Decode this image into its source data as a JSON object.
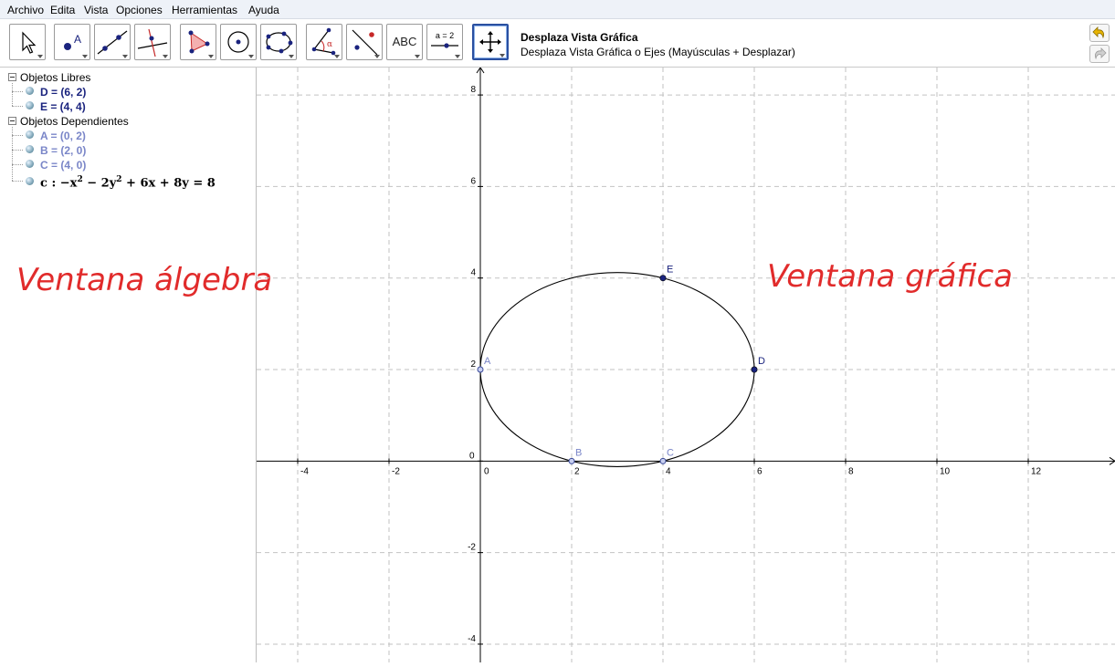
{
  "menu": [
    "Archivo",
    "Edita",
    "Vista",
    "Opciones",
    "Herramientas",
    "Ayuda"
  ],
  "toolbar": {
    "tools": [
      {
        "name": "move-tool-button",
        "icon": "arrow-pointer-icon"
      },
      {
        "name": "point-tool-button",
        "icon": "point-icon"
      },
      {
        "name": "line-tool-button",
        "icon": "line-through-points-icon"
      },
      {
        "name": "perpendicular-tool-button",
        "icon": "perpendicular-line-icon"
      },
      {
        "name": "polygon-tool-button",
        "icon": "polygon-icon"
      },
      {
        "name": "circle-tool-button",
        "icon": "circle-center-point-icon"
      },
      {
        "name": "conic-tool-button",
        "icon": "conic-five-points-icon"
      },
      {
        "name": "angle-tool-button",
        "icon": "angle-icon"
      },
      {
        "name": "reflect-tool-button",
        "icon": "reflect-line-icon"
      },
      {
        "name": "text-tool-button",
        "icon": "text-icon",
        "label": "ABC"
      },
      {
        "name": "slider-tool-button",
        "icon": "slider-icon",
        "label": "a = 2"
      },
      {
        "name": "move-graphics-view-tool-button",
        "icon": "move-view-icon",
        "active": true
      }
    ],
    "help_title": "Desplaza Vista Gráfica",
    "help_desc": "Desplaza Vista Gráfica o Ejes (Mayúsculas + Desplazar)",
    "undo_icon": "undo-icon",
    "redo_icon": "redo-icon"
  },
  "algebra": {
    "free_header": "Objetos Libres",
    "free_items": [
      "D = (6, 2)",
      "E = (4, 4)"
    ],
    "dependent_header": "Objetos Dependientes",
    "dependent_items": [
      "A = (0, 2)",
      "B = (2, 0)",
      "C = (4, 0)"
    ],
    "conic_name": "c :",
    "conic_eq": {
      "p1": "−x",
      "p2": " − 2y",
      "p3": " + 6x + 8y = 8",
      "exp": "2"
    },
    "annotation": "Ventana álgebra"
  },
  "graphics": {
    "annotation": "Ventana gráfica",
    "axes": {
      "x_ticks": [
        "-4",
        "-2",
        "0",
        "2",
        "4",
        "6",
        "8",
        "10",
        "12"
      ],
      "y_ticks": [
        "8",
        "6",
        "4",
        "2",
        "0",
        "-2",
        "-4"
      ],
      "x_range": [
        -4.9,
        13.9
      ],
      "y_range": [
        -4.4,
        8.6
      ]
    },
    "conic": {
      "center": [
        3,
        2
      ],
      "semi_x": 3.0,
      "semi_y": 2.121
    },
    "points": [
      {
        "label": "A",
        "x": 0,
        "y": 2,
        "free": false
      },
      {
        "label": "B",
        "x": 2,
        "y": 0,
        "free": false
      },
      {
        "label": "C",
        "x": 4,
        "y": 0,
        "free": false
      },
      {
        "label": "D",
        "x": 6,
        "y": 2,
        "free": true
      },
      {
        "label": "E",
        "x": 4,
        "y": 4,
        "free": true
      }
    ],
    "colors": {
      "free_point": "#1a237e",
      "dependent_point": "#7a86c8",
      "grid": "#c2c2c2"
    }
  }
}
